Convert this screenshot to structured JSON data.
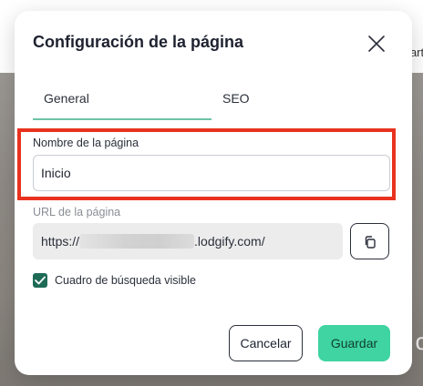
{
  "dialog": {
    "title": "Configuración de la página",
    "close_icon": "close-icon"
  },
  "tabs": [
    {
      "label": "General",
      "active": true
    },
    {
      "label": "SEO",
      "active": false
    }
  ],
  "fields": {
    "page_name": {
      "label": "Nombre de la página",
      "value": "Inicio"
    },
    "page_url": {
      "label": "URL de la página",
      "value_prefix": "https://",
      "value_suffix": ".lodgify.com/",
      "copy_icon": "copy-icon"
    }
  },
  "search_visible": {
    "label": "Cuadro de búsqueda visible",
    "checked": true
  },
  "buttons": {
    "cancel": "Cancelar",
    "save": "Guardar"
  },
  "background": {
    "peek_text": "arti",
    "peek_letter": "o"
  },
  "colors": {
    "accent": "#3fd4a2",
    "checkbox": "#1e6b55",
    "tab_underline": "#6cc2a8",
    "highlight": "#e8321f"
  }
}
